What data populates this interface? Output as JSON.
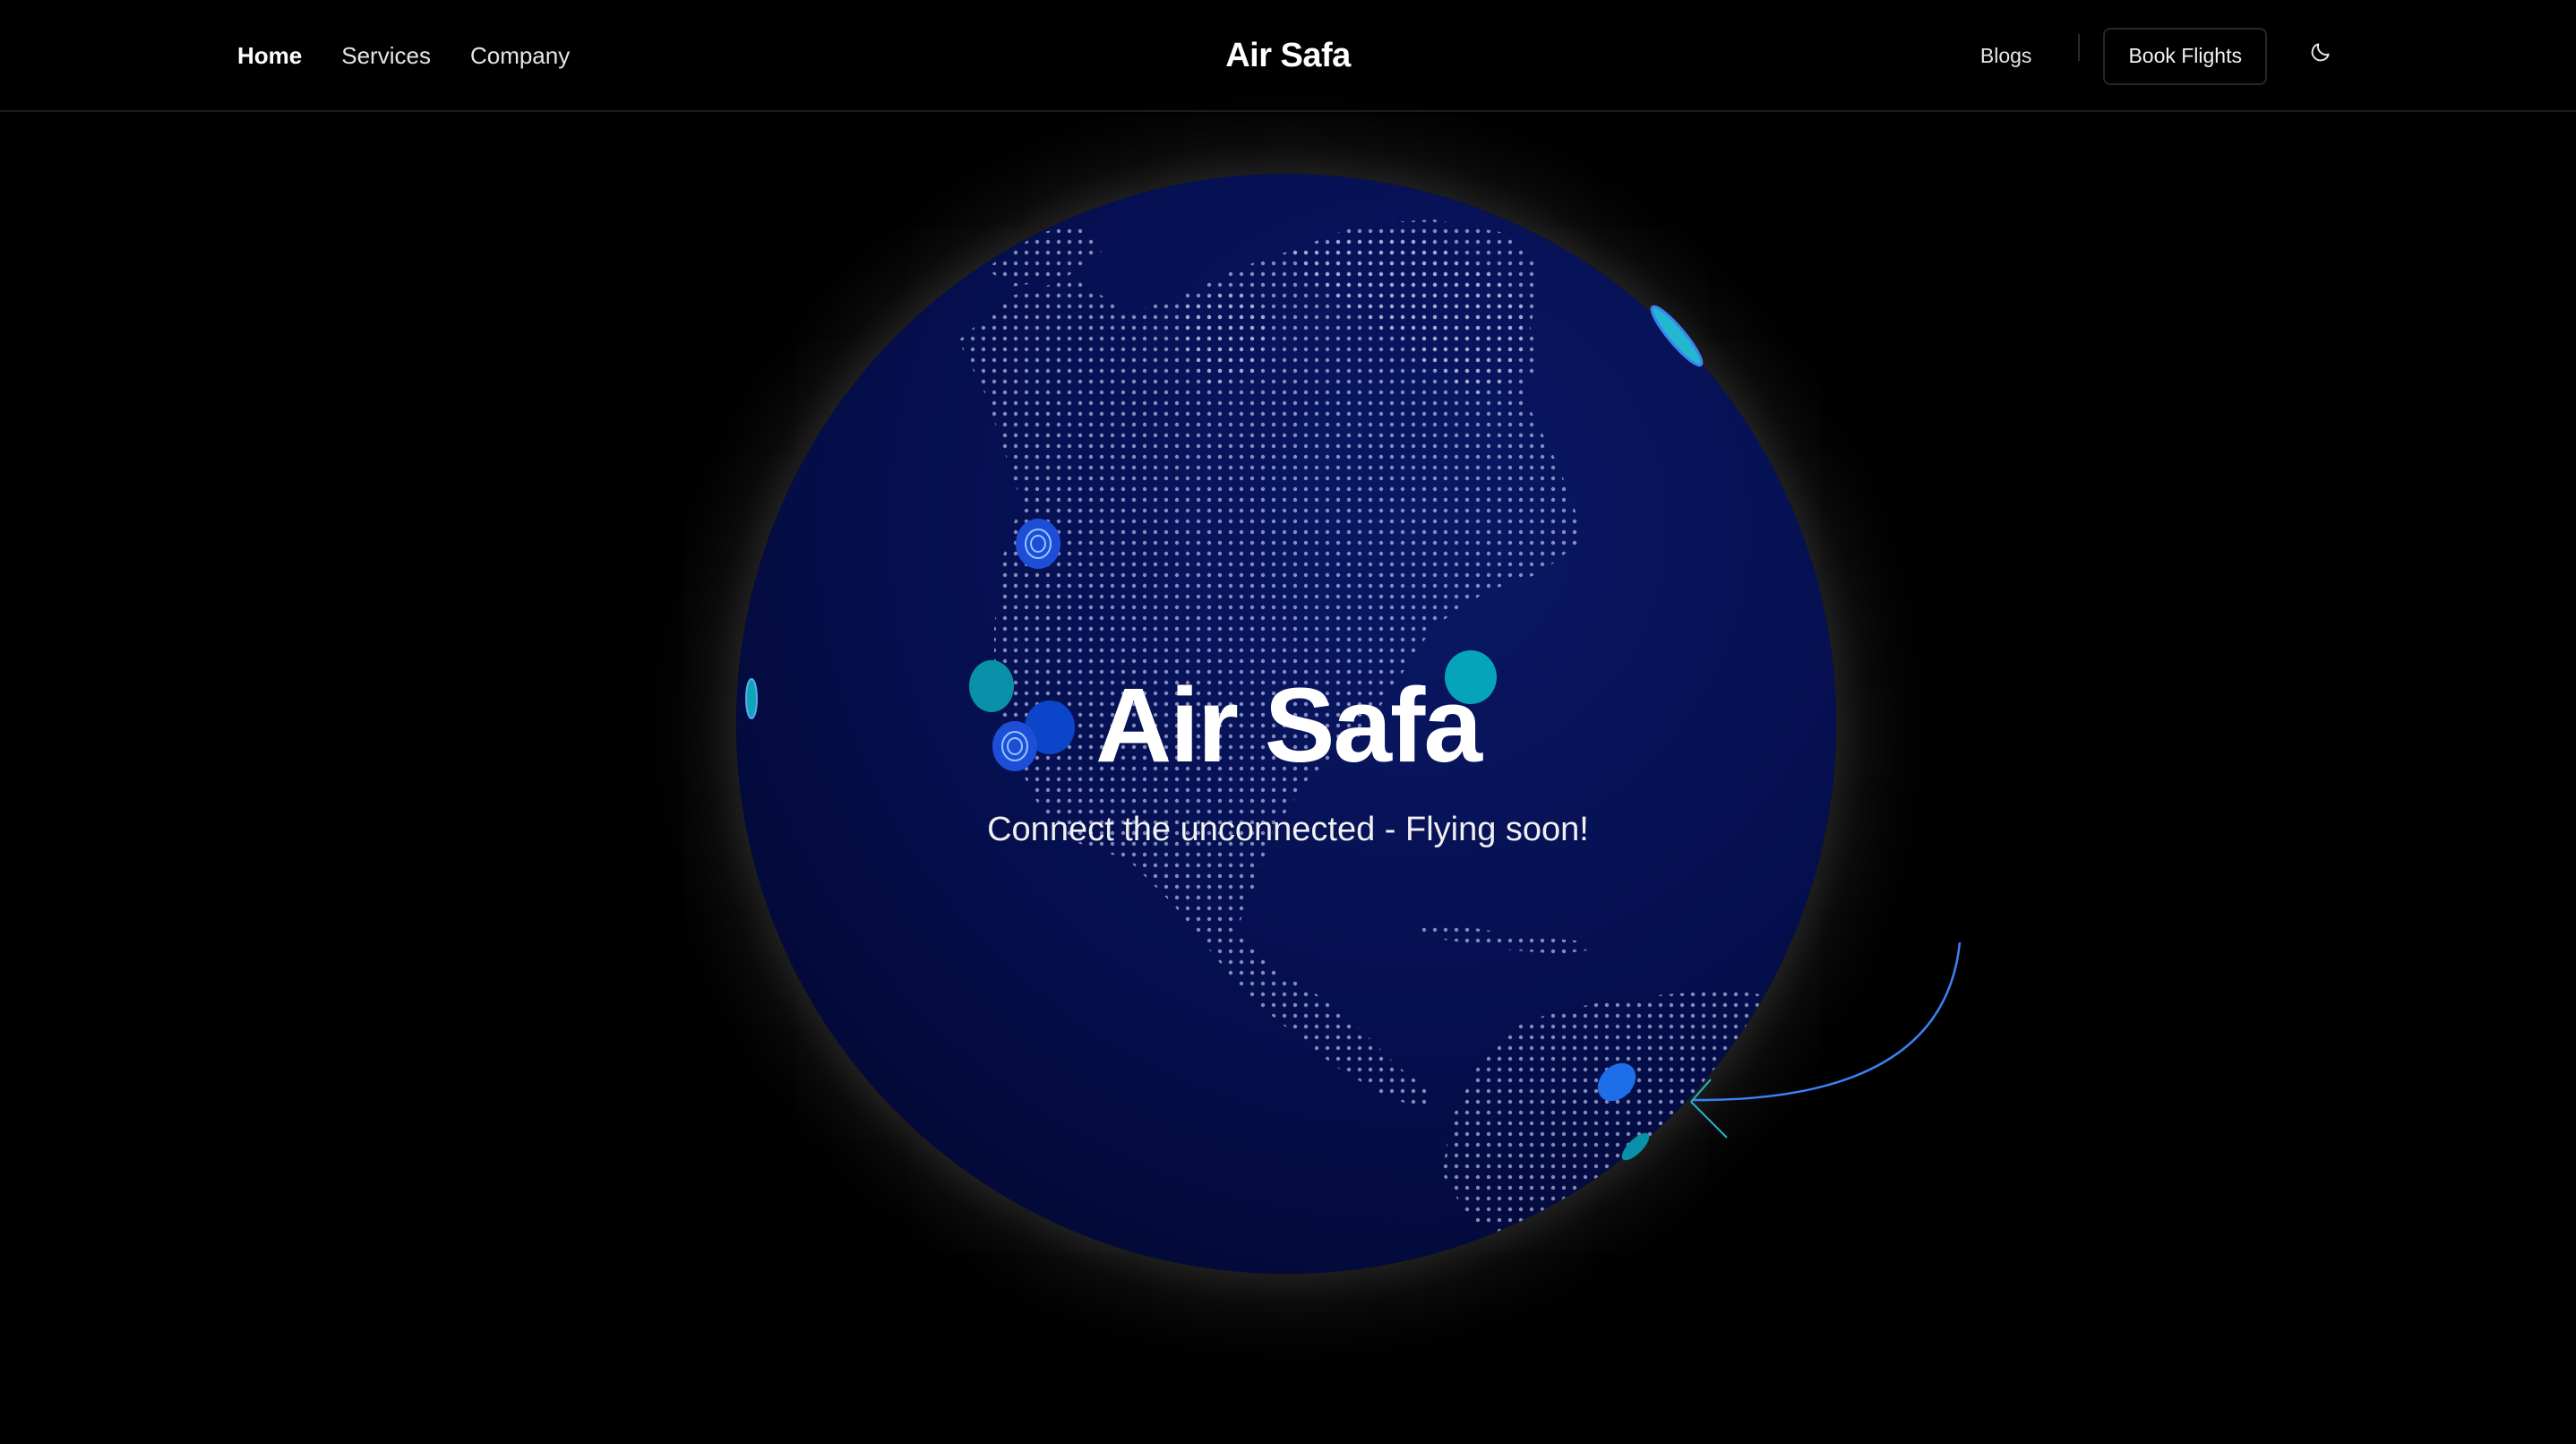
{
  "header": {
    "nav": [
      {
        "label": "Home",
        "active": true
      },
      {
        "label": "Services",
        "active": false
      },
      {
        "label": "Company",
        "active": false
      }
    ],
    "brand": "Air Safa",
    "blogs_label": "Blogs",
    "book_label": "Book Flights",
    "theme_icon": "moon-icon"
  },
  "hero": {
    "title": "Air Safa",
    "subtitle": "Connect the unconnected - Flying soon!"
  },
  "colors": {
    "background": "#000000",
    "globe": "#050f4a",
    "dots": "#aab4dc",
    "marker_teal": "#0ea5b7",
    "marker_blue": "#1d4ed8",
    "arc": "#3b82f6"
  }
}
